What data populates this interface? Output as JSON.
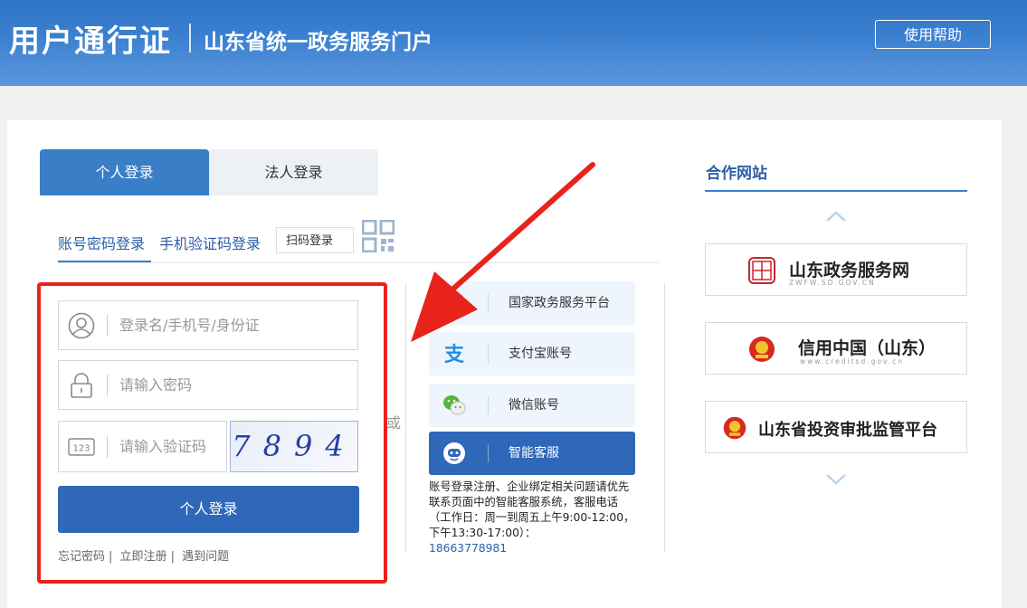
{
  "header": {
    "brand": "用户通行证",
    "subtitle": "山东省统一政务服务门户",
    "help_label": "使用帮助"
  },
  "login": {
    "tabs": [
      "个人登录",
      "法人登录"
    ],
    "subtabs": [
      "账号密码登录",
      "手机验证码登录"
    ],
    "scan_label": "扫码登录",
    "fields": {
      "username_placeholder": "登录名/手机号/身份证",
      "password_placeholder": "请输入密码",
      "captcha_placeholder": "请输入验证码"
    },
    "captcha_text": "7894",
    "submit_label": "个人登录",
    "links": [
      "忘记密码",
      "立即注册",
      "遇到问题"
    ],
    "or_label": "或"
  },
  "third_party": {
    "items": [
      {
        "label": "国家政务服务平台",
        "icon": "national-emblem-icon"
      },
      {
        "label": "支付宝账号",
        "icon": "alipay-icon"
      },
      {
        "label": "微信账号",
        "icon": "wechat-icon"
      },
      {
        "label": "智能客服",
        "icon": "robot-icon"
      }
    ],
    "note": "账号登录注册、企业绑定相关问题请优先联系页面中的智能客服系统，客服电话（工作日：周一到周五上午9:00-12:00，下午13:30-17:00）：",
    "phone": "18663778981"
  },
  "partners": {
    "title": "合作网站",
    "items": [
      {
        "name": "山东政务服务网",
        "url": "ZWFW.SD.GOV.CN",
        "seal": "中国山东"
      },
      {
        "name": "信用中国（山东）",
        "url": "www.creditsd.gov.cn"
      },
      {
        "name": "山东省投资审批监管平台",
        "url": ""
      }
    ]
  },
  "colors": {
    "brand_blue": "#2f68b8",
    "highlight_red": "#e8231c"
  }
}
